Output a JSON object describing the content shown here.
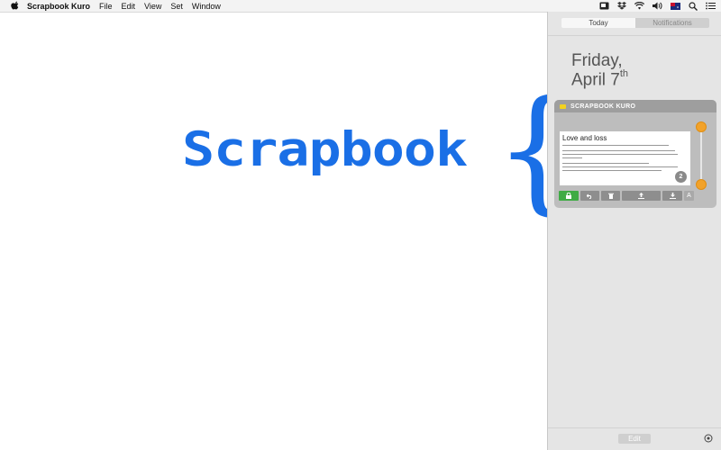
{
  "menubar": {
    "app_name": "Scrapbook Kuro",
    "items": [
      "File",
      "Edit",
      "View",
      "Set",
      "Window"
    ],
    "status_icons": [
      "scrapbook-status-icon",
      "dropbox-icon",
      "wifi-icon",
      "volume-icon",
      "flag-icon",
      "spotlight-icon",
      "notification-center-icon"
    ]
  },
  "main": {
    "wordmark": "Scrapbook",
    "brace": "{"
  },
  "notification_center": {
    "tabs": {
      "today": "Today",
      "notifications": "Notifications"
    },
    "date_line1": "Friday,",
    "date_line2": "April 7",
    "date_suffix": "th",
    "widget": {
      "title": "SCRAPBOOK KURO",
      "note_title": "Love and loss",
      "badge": "2",
      "font_button": "A"
    },
    "edit_label": "Edit"
  },
  "colors": {
    "brand_blue": "#1a6fe6",
    "slider_orange": "#f2a22a",
    "lock_green": "#3fab44"
  }
}
